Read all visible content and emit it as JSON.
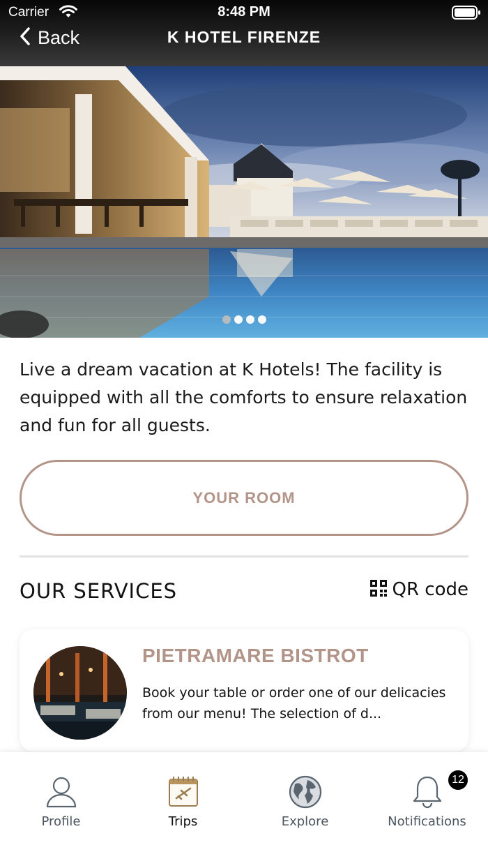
{
  "status_bar": {
    "carrier": "Carrier",
    "time": "8:48 PM"
  },
  "nav": {
    "back_label": "Back",
    "title": "K HOTEL FIRENZE"
  },
  "hero": {
    "slide_count": 4,
    "active_index": 0
  },
  "description": "Live a dream vacation at K Hotels! The facility is equipped with all the comforts to ensure relaxation and fun for all guests.",
  "room_button": {
    "label": "YOUR ROOM"
  },
  "services": {
    "title": "OUR SERVICES",
    "qr_label": "QR code",
    "items": [
      {
        "title": "PIETRAMARE BISTROT",
        "text": "Book your table or order one of our delicacies from our menu! The selection of d..."
      }
    ]
  },
  "tabs": [
    {
      "label": "Profile",
      "icon": "profile-icon"
    },
    {
      "label": "Trips",
      "icon": "trips-icon"
    },
    {
      "label": "Explore",
      "icon": "globe-icon"
    },
    {
      "label": "Notifications",
      "icon": "bell-icon",
      "badge": "12"
    }
  ],
  "colors": {
    "accent": "#b39488",
    "tab_text": "#4a5560"
  }
}
